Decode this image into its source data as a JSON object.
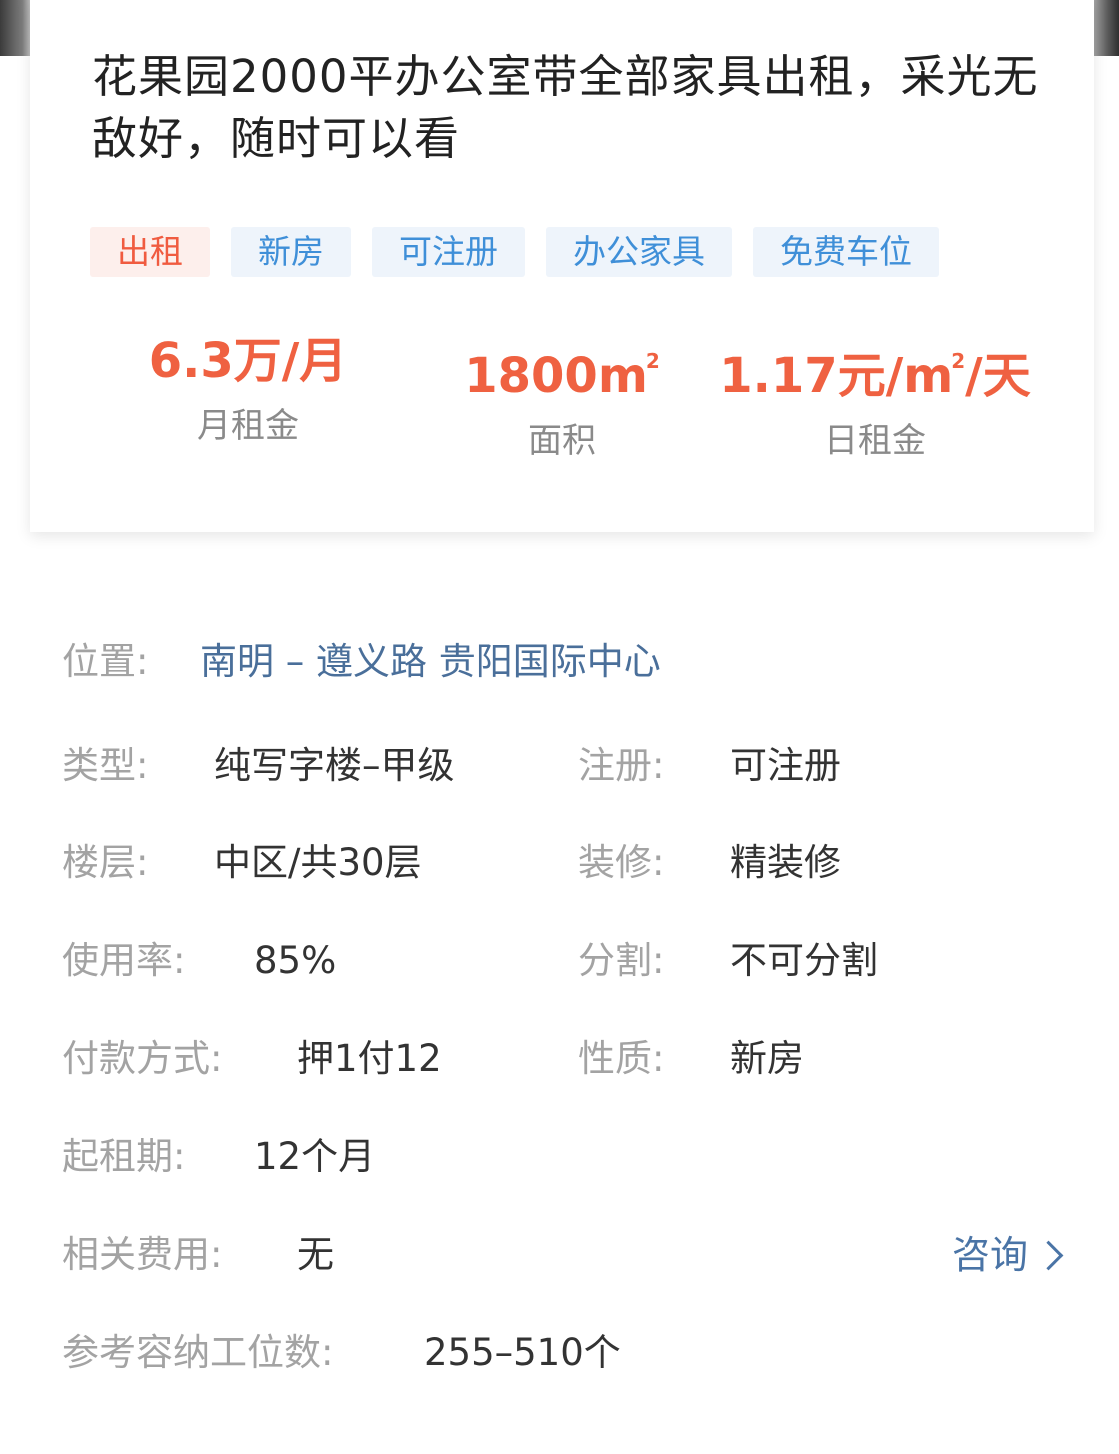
{
  "listing": {
    "title": "花果园2000平办公室带全部家具出租，采光无敌好，随时可以看",
    "tags": [
      {
        "label": "出租",
        "color": "#f05b40"
      },
      {
        "label": "新房",
        "color": "#3f8fd8"
      },
      {
        "label": "可注册",
        "color": "#3f8fd8"
      },
      {
        "label": "办公家具",
        "color": "#3f8fd8"
      },
      {
        "label": "免费车位",
        "color": "#3f8fd8"
      }
    ],
    "stats": {
      "rent_value": "6.3万/月",
      "rent_label": "月租金",
      "area_value": "1800m",
      "area_sup": "2",
      "area_label": "面积",
      "daily_value_a": "1.17元/m",
      "daily_sup": "2",
      "daily_value_b": "/天",
      "daily_label": "日租金"
    }
  },
  "details": {
    "location_key": "位置:",
    "location_value": "南明 – 遵义路 贵阳国际中心",
    "type_key": "类型:",
    "type_value": "纯写字楼–甲级",
    "register_key": "注册:",
    "register_value": "可注册",
    "floor_key": "楼层:",
    "floor_value": "中区/共30层",
    "decoration_key": "装修:",
    "decoration_value": "精装修",
    "usage_key": "使用率:",
    "usage_value": "85%",
    "split_key": "分割:",
    "split_value": "不可分割",
    "payment_key": "付款方式:",
    "payment_value": "押1付12",
    "nature_key": "性质:",
    "nature_value": "新房",
    "lease_key": "起租期:",
    "lease_value": "12个月",
    "fees_key": "相关费用:",
    "fees_value": "无",
    "consult_label": "咨询",
    "capacity_key": "参考容纳工位数:",
    "capacity_value": "255–510个"
  },
  "colors": {
    "accent_red": "#ef6141",
    "tag_blue": "#3f8fd8",
    "link_blue": "#4a6f9a"
  }
}
